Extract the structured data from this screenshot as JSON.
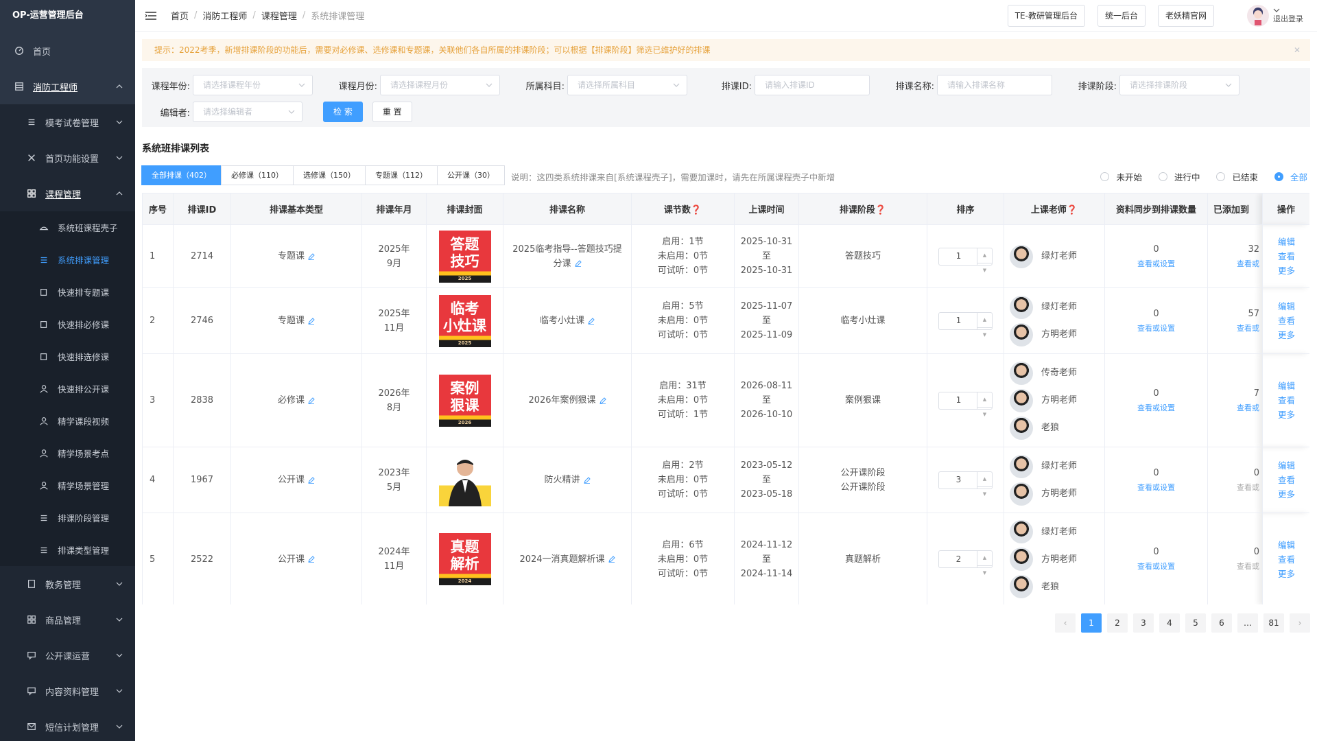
{
  "sidebar": {
    "title": "OP-运营管理后台",
    "home": "首页",
    "group": "消防工程师",
    "items": [
      {
        "label": "模考试卷管理"
      },
      {
        "label": "首页功能设置"
      },
      {
        "label": "课程管理"
      }
    ],
    "course_sub": [
      {
        "label": "系统班课程壳子"
      },
      {
        "label": "系统排课管理"
      },
      {
        "label": "快速排专题课"
      },
      {
        "label": "快速排必修课"
      },
      {
        "label": "快速排选修课"
      },
      {
        "label": "快速排公开课"
      },
      {
        "label": "精学课段视频"
      },
      {
        "label": "精学场景考点"
      },
      {
        "label": "精学场景管理"
      },
      {
        "label": "排课阶段管理"
      },
      {
        "label": "排课类型管理"
      }
    ],
    "bottom": [
      {
        "label": "教务管理"
      },
      {
        "label": "商品管理"
      },
      {
        "label": "公开课运营"
      },
      {
        "label": "内容资料管理"
      },
      {
        "label": "短信计划管理"
      }
    ]
  },
  "topbar": {
    "breadcrumb": [
      "首页",
      "消防工程师",
      "课程管理",
      "系统排课管理"
    ],
    "buttons": [
      "TE-教研管理后台",
      "统一后台",
      "老妖精官网"
    ],
    "user_action": "退出登录"
  },
  "notice": "提示：2022考季，新增排课阶段的功能后，需要对必修课、选修课和专题课，关联他们各自所属的排课阶段；可以根据【排课阶段】筛选已维护好的排课",
  "filters": {
    "year_label": "课程年份:",
    "year_ph": "请选择课程年份",
    "month_label": "课程月份:",
    "month_ph": "请选择课程月份",
    "subject_label": "所属科目:",
    "subject_ph": "请选择所属科目",
    "id_label": "排课ID:",
    "id_ph": "请输入排课ID",
    "name_label": "排课名称:",
    "name_ph": "请输入排课名称",
    "stage_label": "排课阶段:",
    "stage_ph": "请选择排课阶段",
    "editor_label": "编辑者:",
    "editor_ph": "请选择编辑者",
    "search": "检 索",
    "reset": "重 置"
  },
  "list_title": "系统班排课列表",
  "tabs": [
    "全部排课（402）",
    "必修课（110）",
    "选修课（150）",
    "专题课（112）",
    "公开课（30）"
  ],
  "tabs_note": "说明：这四类系统排课来自[系统课程壳子]，需要加课时，请先在所属课程壳子中新增",
  "radios": [
    "未开始",
    "进行中",
    "已结束",
    "全部"
  ],
  "columns": [
    "序号",
    "排课ID",
    "排课基本类型",
    "排课年月",
    "排课封面",
    "排课名称",
    "课节数",
    "上课时间",
    "排课阶段",
    "排序",
    "上课老师",
    "资料同步到排课数量",
    "已添加到",
    "操作"
  ],
  "rows": [
    {
      "no": "1",
      "id": "2714",
      "type": "专题课",
      "ym1": "2025年",
      "ym2": "9月",
      "cover1": "答题",
      "cover2": "技巧",
      "cover_yr": "2025",
      "name": "2025临考指导--答题技巧提分课",
      "s1": "启用：1节",
      "s2": "未启用：0节",
      "s3": "可试听：0节",
      "t1": "2025-10-31",
      "t2": "至",
      "t3": "2025-10-31",
      "stage": "答题技巧",
      "order": "1",
      "teachers": [
        "绿灯老师"
      ],
      "sync": "0",
      "sync_link": "查看或设置",
      "added": "32",
      "added_link": "查看或"
    },
    {
      "no": "2",
      "id": "2746",
      "type": "专题课",
      "ym1": "2025年",
      "ym2": "11月",
      "cover1": "临考",
      "cover2": "小灶课",
      "cover_yr": "2025",
      "name": "临考小灶课",
      "s1": "启用：5节",
      "s2": "未启用：0节",
      "s3": "可试听：0节",
      "t1": "2025-11-07",
      "t2": "至",
      "t3": "2025-11-09",
      "stage": "临考小灶课",
      "order": "1",
      "teachers": [
        "绿灯老师",
        "方明老师"
      ],
      "sync": "0",
      "sync_link": "查看或设置",
      "added": "57",
      "added_link": "查看或"
    },
    {
      "no": "3",
      "id": "2838",
      "type": "必修课",
      "ym1": "2026年",
      "ym2": "8月",
      "cover1": "案例",
      "cover2": "狠课",
      "cover_yr": "2026",
      "name": "2026年案例狠课",
      "s1": "启用：31节",
      "s2": "未启用：0节",
      "s3": "可试听：1节",
      "t1": "2026-08-11",
      "t2": "至",
      "t3": "2026-10-10",
      "stage": "案例狠课",
      "order": "1",
      "teachers": [
        "传奇老师",
        "方明老师",
        "老狼"
      ],
      "sync": "0",
      "sync_link": "查看或设置",
      "added": "7",
      "added_link": "查看或"
    },
    {
      "no": "4",
      "id": "1967",
      "type": "公开课",
      "ym1": "2023年",
      "ym2": "5月",
      "cover1": "",
      "cover2": "",
      "cover_yr": "",
      "name": "防火精讲",
      "s1": "启用：2节",
      "s2": "未启用：0节",
      "s3": "可试听：0节",
      "t1": "2023-05-12",
      "t2": "至",
      "t3": "2023-05-18",
      "stage": "公开课阶段\n公开课阶段",
      "order": "3",
      "teachers": [
        "绿灯老师",
        "方明老师"
      ],
      "sync": "0",
      "sync_link": "查看或设置",
      "added": "0",
      "added_link": "查看或"
    },
    {
      "no": "5",
      "id": "2522",
      "type": "公开课",
      "ym1": "2024年",
      "ym2": "11月",
      "cover1": "真题",
      "cover2": "解析",
      "cover_yr": "2024",
      "name": "2024一消真题解析课",
      "s1": "启用：6节",
      "s2": "未启用：0节",
      "s3": "可试听：0节",
      "t1": "2024-11-12",
      "t2": "至",
      "t3": "2024-11-14",
      "stage": "真题解析",
      "order": "2",
      "teachers": [
        "绿灯老师",
        "方明老师",
        "老狼"
      ],
      "sync": "0",
      "sync_link": "查看或设置",
      "added": "0",
      "added_link": "查看或"
    }
  ],
  "ops": [
    "编辑",
    "查看",
    "更多"
  ],
  "pager": [
    "1",
    "2",
    "3",
    "4",
    "5",
    "6",
    "…",
    "81"
  ]
}
